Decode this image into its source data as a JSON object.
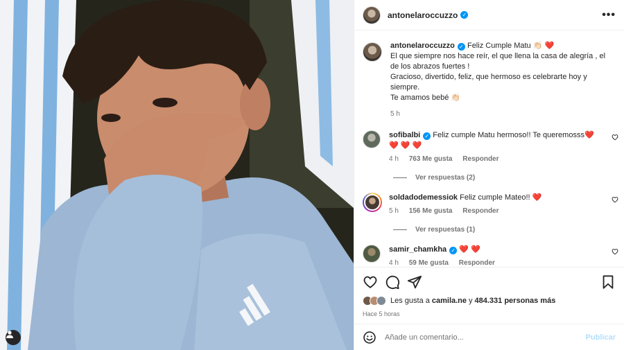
{
  "post": {
    "author": "antonelaroccuzzo",
    "more_icon": "more-horizontal-icon"
  },
  "caption": {
    "author": "antonelaroccuzzo",
    "text_first": "Feliz Cumple Matu 👏🏻 ❤️",
    "line2": "El que siempre nos hace reír, el que llena la casa de alegría , el de los abrazos fuertes !",
    "line3": "Gracioso, divertido, feliz, que hermoso es celebrarte hoy y siempre.",
    "line4": "Te amamos bebé 👏🏻",
    "time": "5 h"
  },
  "comments": [
    {
      "user": "sofibalbi",
      "verified": true,
      "text": "Feliz cumple Matu hermoso!! Te queremosss❤️ ❤️ ❤️ ❤️",
      "time": "4 h",
      "likes": "763 Me gusta",
      "reply": "Responder",
      "replies": "Ver respuestas (2)"
    },
    {
      "user": "soldadodemessiok",
      "verified": false,
      "text": "Feliz cumple Mateo!! ❤️",
      "time": "5 h",
      "likes": "156 Me gusta",
      "reply": "Responder",
      "replies": "Ver respuestas (1)"
    },
    {
      "user": "samir_chamkha",
      "verified": true,
      "text": "❤️ ❤️",
      "time": "4 h",
      "likes": "59 Me gusta",
      "reply": "Responder"
    }
  ],
  "actions": {
    "likes_prefix": "Les gusta a ",
    "liker": "camila.ne",
    "likes_mid": " y ",
    "likes_count": "484.331 personas más",
    "time_ago": "Hace 5 horas"
  },
  "composer": {
    "placeholder": "Añade un comentario...",
    "publish": "Publicar"
  },
  "colors": {
    "verified": "#0095f6",
    "heart": "#ed4956",
    "publish_disabled": "#b2dffc"
  }
}
